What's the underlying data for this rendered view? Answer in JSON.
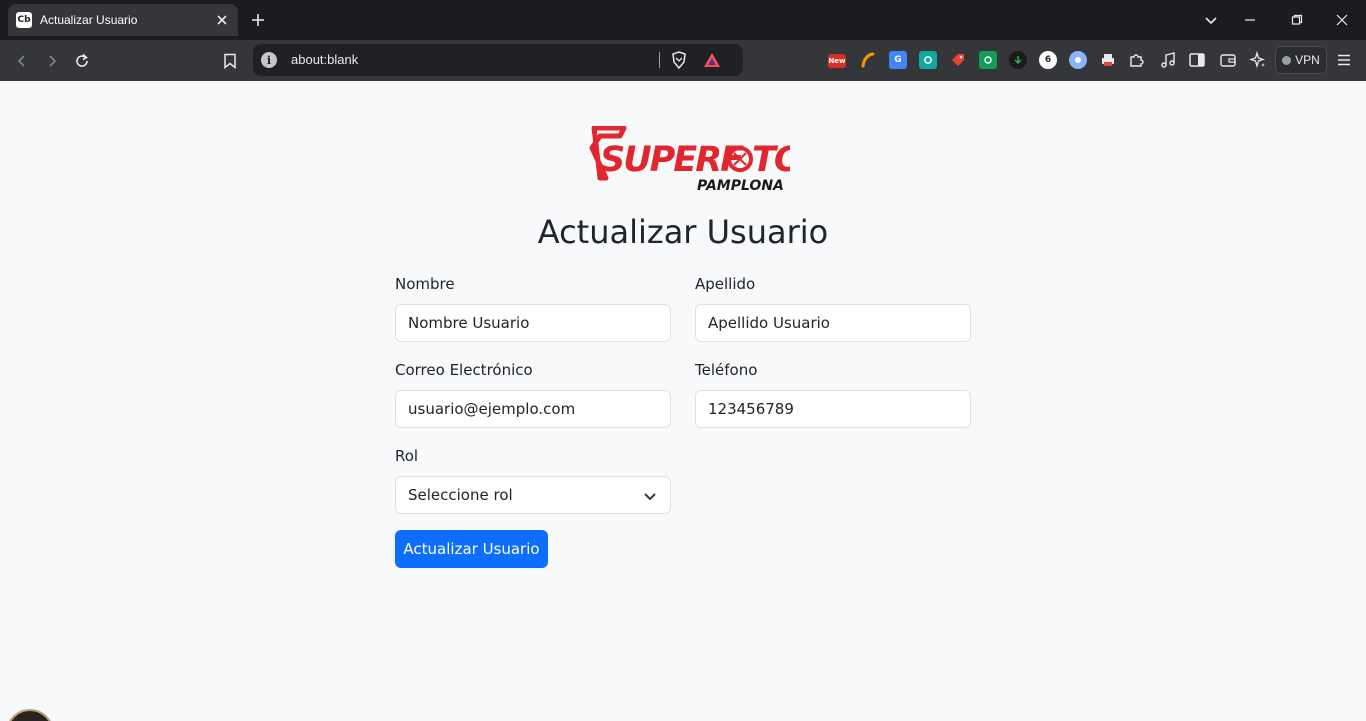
{
  "browser": {
    "tab": {
      "title": "Actualizar Usuario",
      "favicon_text": "Cb"
    },
    "omnibox": {
      "url": "about:blank"
    },
    "vpn_label": "VPN",
    "extensions": [
      {
        "name": "new-badge-extension",
        "text": "New",
        "color": "#d93025"
      },
      {
        "name": "orange-extension",
        "text": "",
        "color": "#f29900"
      },
      {
        "name": "translate-extension",
        "text": "G",
        "color": "#4285f4"
      },
      {
        "name": "teal-extension",
        "text": "",
        "color": "#12a89d"
      },
      {
        "name": "tag-extension",
        "text": "",
        "color": "#ea4335"
      },
      {
        "name": "green-extension",
        "text": "",
        "color": "#0f9d58"
      },
      {
        "name": "download-extension",
        "text": "",
        "color": "#1e8e3e"
      },
      {
        "name": "six-extension",
        "text": "6",
        "color": "#ffffff"
      },
      {
        "name": "blue-circle-extension",
        "text": "",
        "color": "#8ab4f8"
      },
      {
        "name": "printer-extension",
        "text": "",
        "color": "#9aa0a6"
      }
    ]
  },
  "page": {
    "logo": {
      "brand": "SUPERFOTO",
      "sub": "PAMPLONA",
      "color": "#e0262e"
    },
    "title": "Actualizar Usuario",
    "form": {
      "nombre": {
        "label": "Nombre",
        "value": "Nombre Usuario"
      },
      "apellido": {
        "label": "Apellido",
        "value": "Apellido Usuario"
      },
      "correo": {
        "label": "Correo Electrónico",
        "value": "usuario@ejemplo.com"
      },
      "telefono": {
        "label": "Teléfono",
        "value": "123456789"
      },
      "rol": {
        "label": "Rol",
        "selected": "Seleccione rol"
      },
      "submit_label": "Actualizar Usuario"
    },
    "accent_color": "#0d6efd"
  }
}
